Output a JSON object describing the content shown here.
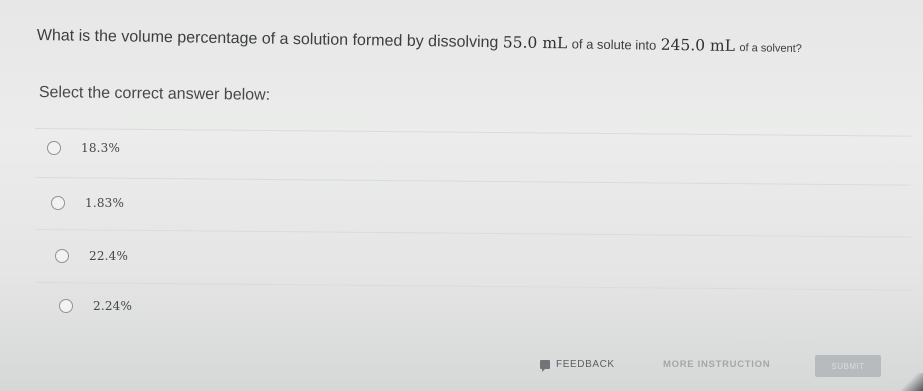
{
  "question": {
    "prefix": "What is the volume percentage of a solution formed by dissolving",
    "solute_volume": "55.0 mL",
    "middle": "of a solute into",
    "solvent_volume": "245.0 mL",
    "suffix": "of a solvent?"
  },
  "instruction": "Select the correct answer below:",
  "choices": [
    {
      "label": "18.3%"
    },
    {
      "label": "1.83%"
    },
    {
      "label": "22.4%"
    },
    {
      "label": "2.24%"
    }
  ],
  "footer": {
    "feedback_label": "FEEDBACK",
    "feedback_icon": "feedback-icon",
    "more_instruction_label": "MORE INSTRUCTION",
    "submit_label": "SUBMIT"
  }
}
